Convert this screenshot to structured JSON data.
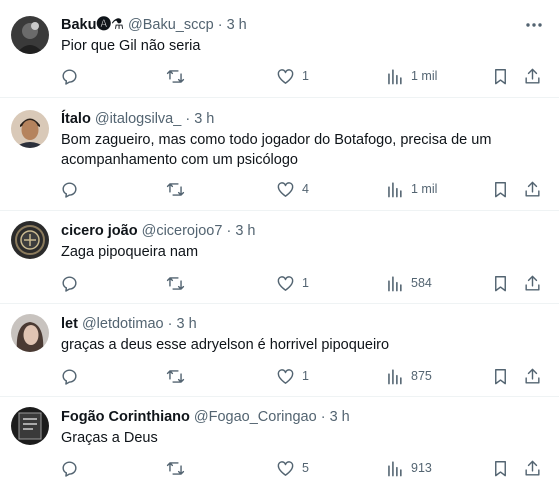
{
  "colors": {
    "text": "#0f1419",
    "muted": "#536471",
    "divider": "#eff3f4"
  },
  "icons": {
    "reply": "speech-bubble-icon",
    "retweet": "retweet-icon",
    "like": "heart-icon",
    "views": "bar-chart-icon",
    "bookmark": "bookmark-icon",
    "share": "share-upload-icon",
    "more": "more-dots-icon"
  },
  "tweets": [
    {
      "name": "Baku🅐⚗",
      "handle": "@Baku_sccp",
      "dot": "·",
      "time": "3 h",
      "lines": [
        "Pior que Gil não seria"
      ],
      "likes": "1",
      "views": "1 mil"
    },
    {
      "name": "Ítalo",
      "handle": "@italogsilva_",
      "dot": "·",
      "time": "3 h",
      "lines": [
        "Bom zagueiro, mas como todo jogador do Botafogo, precisa de um",
        "acompanhamento com um psicólogo"
      ],
      "likes": "4",
      "views": "1 mil"
    },
    {
      "name": "cicero joão",
      "handle": "@cicerojoo7",
      "dot": "·",
      "time": "3 h",
      "lines": [
        "Zaga pipoqueira nam"
      ],
      "likes": "1",
      "views": "584"
    },
    {
      "name": "let",
      "handle": "@letdotimao",
      "dot": "·",
      "time": "3 h",
      "lines": [
        "graças a deus esse adryelson é horrivel pipoqueiro"
      ],
      "likes": "1",
      "views": "875"
    },
    {
      "name": "Fogão Corinthiano",
      "handle": "@Fogao_Coringao",
      "dot": "·",
      "time": "3 h",
      "lines": [
        "Graças a Deus"
      ],
      "likes": "5",
      "views": "913"
    }
  ]
}
